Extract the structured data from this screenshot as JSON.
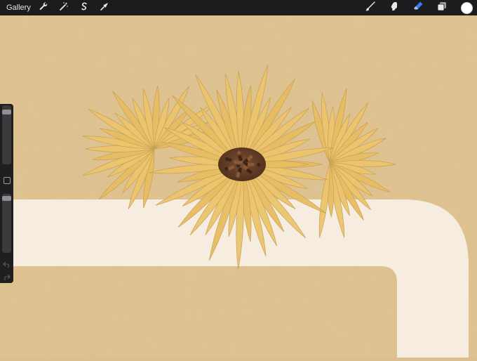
{
  "toolbar": {
    "gallery_label": "Gallery",
    "left_icons": [
      "wrench-icon",
      "magic-wand-icon",
      "selection-icon",
      "transform-arrow-icon"
    ],
    "right_icons": [
      "brush-icon",
      "smudge-icon",
      "eraser-icon",
      "layers-icon"
    ],
    "active_tool": "eraser",
    "current_color": "#ffffff"
  },
  "sidebar": {
    "brush_size_level": 0.05,
    "opacity_level": 0.02
  },
  "colors": {
    "background": "#dcbf8c",
    "cream_shape": "#f6ede0",
    "petal": "#ecc56c",
    "petal_shadow": "#c9a255",
    "flower_center": "#5e3a24",
    "accent_blue": "#3a7bf0"
  }
}
